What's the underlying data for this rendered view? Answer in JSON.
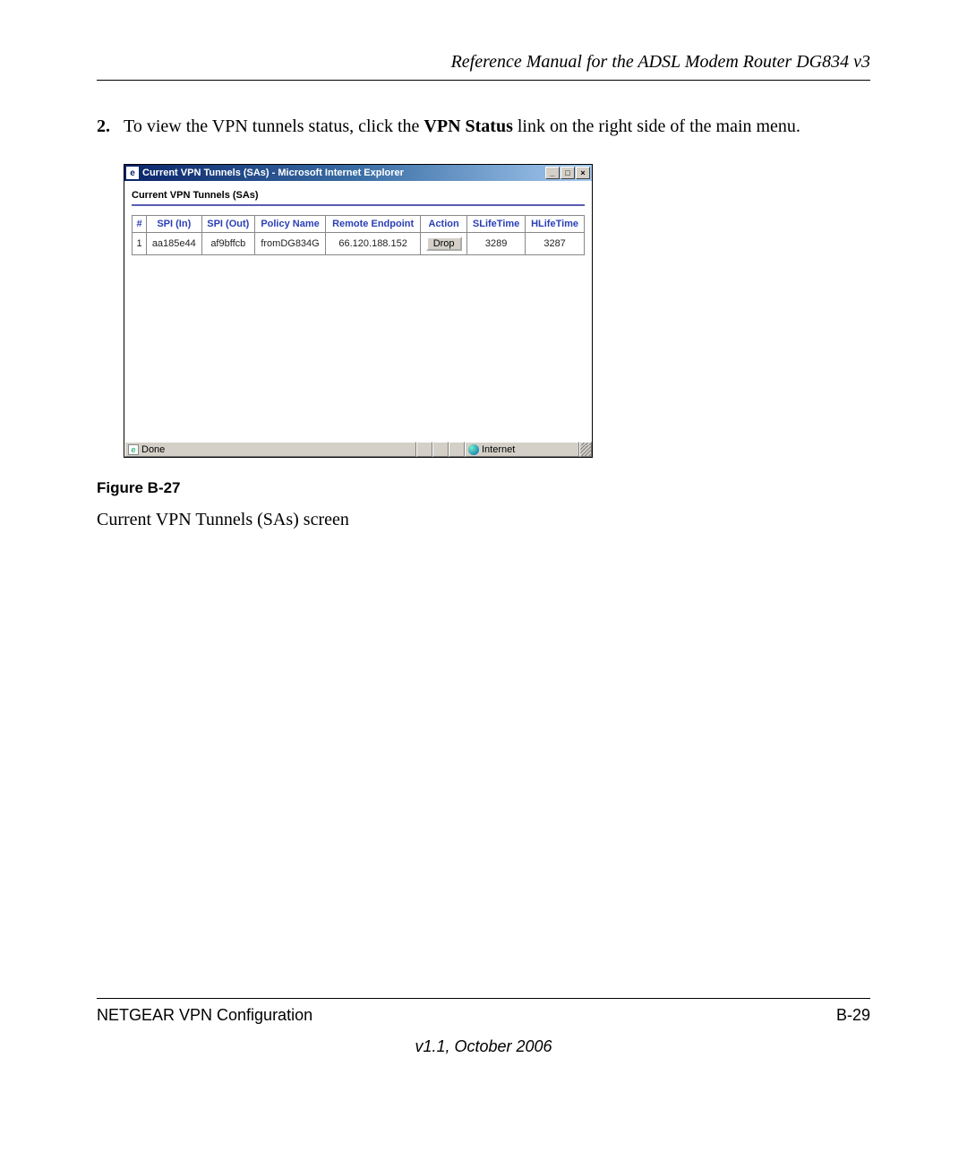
{
  "doc": {
    "header_title": "Reference Manual for the ADSL Modem Router DG834 v3",
    "step_number": "2.",
    "step_text_pre": "To view the VPN tunnels status, click the ",
    "step_text_bold": "VPN Status",
    "step_text_post": " link on the right side of the main menu.",
    "figure_label": "Figure B-27",
    "figure_desc": "Current VPN Tunnels (SAs) screen",
    "footer_left": "NETGEAR VPN Configuration",
    "footer_right": "B-29",
    "footer_version": "v1.1, October 2006"
  },
  "window": {
    "title": "Current VPN Tunnels (SAs) - Microsoft Internet Explorer",
    "section_header": "Current VPN Tunnels (SAs)",
    "status_done": "Done",
    "status_zone": "Internet",
    "buttons": {
      "min": "_",
      "max": "□",
      "close": "×"
    },
    "table": {
      "headers": [
        "#",
        "SPI (In)",
        "SPI (Out)",
        "Policy Name",
        "Remote Endpoint",
        "Action",
        "SLifeTime",
        "HLifeTime"
      ],
      "row": {
        "num": "1",
        "spi_in": "aa185e44",
        "spi_out": "af9bffcb",
        "policy": "fromDG834G",
        "endpoint": "66.120.188.152",
        "action": "Drop",
        "slife": "3289",
        "hlife": "3287"
      }
    }
  }
}
